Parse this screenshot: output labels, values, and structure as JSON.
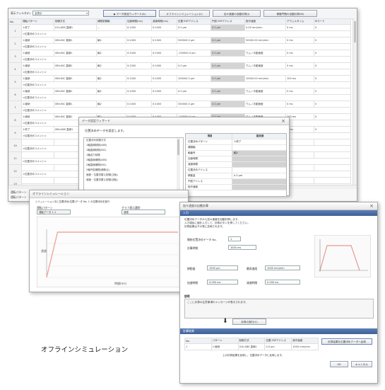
{
  "main_window": {
    "filter_label": "表示フィルタ(F)",
    "filter_value": "全表示",
    "toolbar_buttons": [
      "データ設定ウィザード(A)",
      "オフラインシミュレーション(L)",
      "加々速度の自動計算(J)",
      "移動門限の自動計算(W)"
    ],
    "columns": [
      "No.",
      "運転パターン",
      "制御方式",
      "補間制御軸",
      "加速時間(ms)",
      "減速時間(ms)",
      "位置 ESPアドレス",
      "円弧 ESPアドレス",
      "指令速度",
      "デウェルタイム",
      "Mコード"
    ],
    "rows": [
      {
        "no": "1",
        "pattern": "1:終了",
        "method": "01h:ABS 直線1",
        "axis": "--",
        "acc": "0:1000",
        "dec": "0:1000",
        "pos": "0.0 μm",
        "arc": "0.0 μm",
        "speed": "0.00 mm/min",
        "dwell": "0 ms",
        "m": "0",
        "sub": "<位置決めコメント>"
      },
      {
        "no": "2",
        "pattern": "1:継続",
        "method": "0Bh:INC 直線1",
        "axis": "軸2",
        "acc": "0:1000",
        "dec": "0:1000",
        "pos": "300000.0 μm",
        "arc": "0.0 μm",
        "speed": "50000.00 mm/min",
        "dwell": "0 ms",
        "m": "0",
        "sub": "<位置決めコメント>"
      },
      {
        "no": "3",
        "pattern": "1:継続",
        "method": "0Bh:INC 直線1",
        "axis": "軸2",
        "acc": "0:1000",
        "dec": "0:1000",
        "pos": "-100000.0 μm",
        "arc": "0.0 μm",
        "speed": "ウムノ手動速度",
        "dwell": "0 ms",
        "m": "0",
        "sub": "<位置決めコメント>"
      },
      {
        "no": "4",
        "pattern": "1:継続",
        "method": "0Bh:INC 直線1",
        "axis": "軸2",
        "acc": "0:1000",
        "dec": "0:1000",
        "pos": "0.0 μm",
        "arc": "0.0 μm",
        "speed": "ウムノ手動速度",
        "dwell": "0 ms",
        "m": "0",
        "sub": "<位置決めコメント>"
      },
      {
        "no": "5",
        "pattern": "1:継続",
        "method": "0Bh:INC 直線1",
        "axis": "軸2",
        "acc": "0:1000",
        "dec": "0:1000",
        "pos": "100000.0 μm",
        "arc": "0.0 μm",
        "speed": "10000.00 mm/min",
        "dwell": "100 ms",
        "m": "0",
        "sub": "<位置決めコメント>"
      },
      {
        "no": "6",
        "pattern": "1:継続",
        "method": "0Bh:INC 直線1",
        "axis": "軸2",
        "acc": "0:1000",
        "dec": "0:1000",
        "pos": "0.0 μm",
        "arc": "0.0 μm",
        "speed": "ウムノ手動速度",
        "dwell": "0 ms",
        "m": "0",
        "sub": "<位置決めコメント>"
      },
      {
        "no": "7",
        "pattern": "1:継続",
        "method": "0Bh:INC 直線1",
        "axis": "軸2",
        "acc": "0:1000",
        "dec": "0:1000",
        "pos": "300000.0 μm",
        "arc": "0.0 μm",
        "speed": "ウムノ手動速度",
        "dwell": "0 ms",
        "m": "0",
        "sub": "<位置決めコメント>"
      },
      {
        "no": "8",
        "pattern": "1:継続",
        "method": "0Bh:INC 直線1",
        "axis": "軸2",
        "acc": "0:1000",
        "dec": "0:1000",
        "pos": "-100000.0 μm",
        "arc": "0.0 μm",
        "speed": "ウムノ手動速度",
        "dwell": "100 ms",
        "m": "0",
        "sub": "<位置決めコメント>"
      },
      {
        "no": "9",
        "pattern": "1:終了",
        "method": "0Bh:ABS 直線1",
        "axis": "軸2",
        "acc": "0:1000",
        "dec": "0:1000",
        "pos": "0.0 μm",
        "arc": "0.0 μm",
        "speed": "6782.00 mm/min",
        "dwell": "0 ms",
        "m": "0",
        "sub": "<位置決めコメント>"
      },
      {
        "no": "10",
        "pattern": "",
        "method": "",
        "axis": "",
        "acc": "",
        "dec": "",
        "pos": "",
        "arc": "",
        "speed": "",
        "dwell": "",
        "m": "",
        "sub": "<位置決めコメント>"
      },
      {
        "no": "11",
        "pattern": "",
        "method": "",
        "axis": "",
        "acc": "",
        "dec": "",
        "pos": "",
        "arc": "",
        "speed": "",
        "dwell": "",
        "m": "",
        "sub": "<位置決めコメント>"
      },
      {
        "no": "12",
        "pattern": "",
        "method": "",
        "axis": "",
        "acc": "",
        "dec": "",
        "pos": "",
        "arc": "",
        "speed": "",
        "dwell": "",
        "m": "",
        "sub": "<位置決めコメント>"
      },
      {
        "no": "13",
        "pattern": "",
        "method": "",
        "axis": "",
        "acc": "",
        "dec": "",
        "pos": "",
        "arc": "",
        "speed": "",
        "dwell": "",
        "m": "",
        "sub": "<位置決めコメント>"
      }
    ],
    "bottom_labels": [
      "運転パターン",
      "運転パターン"
    ]
  },
  "wizard_dialog": {
    "title": "データ設定ウィザード",
    "instruction": "位置決めデータを設定します。",
    "list_items": [
      "位置決め制御方式",
      "1軸直線制御(ABS)",
      "1軸直線制御(INC)",
      "1軸送り制御",
      "2軸直線補間(ABS)",
      "2軸直線補間(INC)",
      "2軸円弧補間(補助点)",
      "速度・位置切替え制御(正転)",
      "速度・位置切替え制御(逆転)"
    ],
    "prop_header": [
      "項目",
      "設定値"
    ],
    "props": [
      {
        "k": "位置決めパターン",
        "v": "1:終了",
        "gray": false
      },
      {
        "k": "補間軸",
        "v": "",
        "gray": false
      },
      {
        "k": "軸番号",
        "v": "軸2",
        "gray": true
      },
      {
        "k": "加速時間",
        "v": "",
        "gray": true
      },
      {
        "k": "減速時間",
        "v": "",
        "gray": true
      },
      {
        "k": "位置決めアドレス",
        "v": "",
        "gray": false
      },
      {
        "k": "移動量",
        "v": "0.0 μm",
        "gray": false
      },
      {
        "k": "円弧アドレス",
        "v": "",
        "gray": true
      },
      {
        "k": "指令速度",
        "v": "",
        "gray": true
      }
    ]
  },
  "sim_window": {
    "title": "オフラインシミュレーション",
    "info_text": "シミュレーション中に位置決め(位置)データ No. 1 の位置決めを実行",
    "pattern_label": "運転パターン",
    "pattern_value": "運転データ 1.1",
    "graph_label": "グラフ表示選択",
    "graph_value": "速度",
    "x_axis_label": "時間(ms)",
    "y_axis_label": "速度",
    "chart_data": {
      "type": "line",
      "x": [
        0,
        1,
        2,
        10,
        12
      ],
      "y": [
        0,
        100,
        100,
        100,
        100
      ]
    }
  },
  "calc_window": {
    "title": "加々速度の自動計算",
    "section_title": "入力",
    "desc_lines": [
      "位置決めデータから加々速度を自動計算します。",
      "入力項目に値を入力して、計算ボタンを押してください。",
      "計算結果は下の表に反映されます。"
    ],
    "fields": [
      {
        "label": "開始位置決めデータ No.",
        "value": "1"
      },
      {
        "label": "計算時間",
        "value": "1000 ms"
      },
      {
        "label": "移動量",
        "value": "1000 μm"
      },
      {
        "label": "最高速度",
        "value": "1000 mm/min"
      },
      {
        "label": "加速時間",
        "value": "0.000 ms"
      },
      {
        "label": "減速時間",
        "value": "0.000 ms"
      }
    ],
    "notes_title": "説明",
    "notes_text": "ここに計算の注意事項やメッセージが表示されます。",
    "calc_button": "計算の実行(C)",
    "result_title": "計算結果",
    "result_headers": [
      "No.",
      "パターン",
      "制御方式",
      "位置 ESPアドレス",
      "指令速度"
    ],
    "result_row": [
      "1",
      "1:継続",
      "01h:ABS 直線1",
      "0.0 μm",
      "1000 mm/min"
    ],
    "result_button": "計算結果を位置決めデータへ反映",
    "footer_text": "上の計算結果を反映し、位置決めデータに反映します。",
    "ok_button": "OK",
    "cancel_button": "キャンセル"
  },
  "caption": "オフラインシミュレーション"
}
